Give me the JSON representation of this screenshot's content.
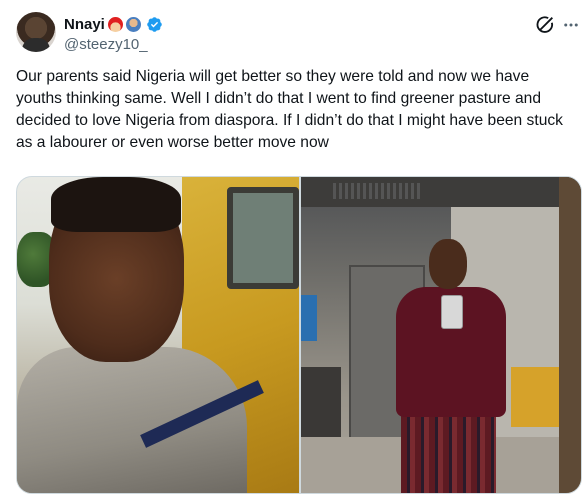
{
  "author": {
    "display_name": "Nnayi",
    "handle": "@steezy10_",
    "emojis": [
      "santa-emoji",
      "person-emoji"
    ],
    "verified": true
  },
  "post": {
    "text": "Our parents said Nigeria will get better so they were told and now we have youths thinking same. Well I didn’t do that I went to find greener pasture and decided to love Nigeria from diaspora. If I didn’t do that I might have been stuck as a labourer or even worse better move now"
  },
  "media": {
    "count": 2
  },
  "icons": {
    "verified": "verified-badge-icon",
    "grok": "grok-icon",
    "more": "more-horizontal-icon"
  },
  "colors": {
    "text": "#0f1419",
    "secondary_text": "#536471",
    "verified_blue": "#1d9bf0",
    "border": "#cfd9de"
  }
}
